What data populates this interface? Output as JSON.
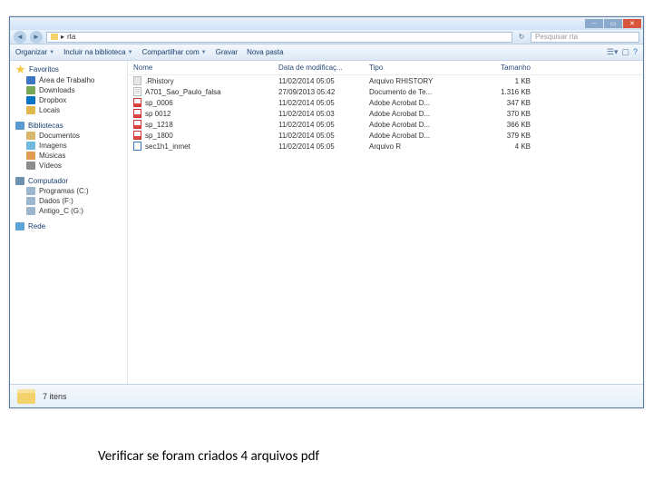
{
  "window": {
    "path_folder": "rta",
    "search_placeholder": "Pesquisar rta"
  },
  "toolbar": {
    "organize": "Organizar",
    "include": "Incluir na biblioteca",
    "share": "Compartilhar com",
    "burn": "Gravar",
    "newfolder": "Nova pasta"
  },
  "columns": {
    "name": "Nome",
    "date": "Data de modificaç...",
    "type": "Tipo",
    "size": "Tamanho"
  },
  "sidebar": {
    "favorites": "Favoritos",
    "desktop": "Área de Trabalho",
    "downloads": "Downloads",
    "dropbox": "Dropbox",
    "locals": "Locais",
    "libraries": "Bibliotecas",
    "documents": "Documentos",
    "images": "Imagens",
    "music": "Músicas",
    "videos": "Vídeos",
    "computer": "Computador",
    "drive_c": "Programas (C:)",
    "drive_f": "Dados (F:)",
    "drive_g": "Antigo_C (G:)",
    "network": "Rede"
  },
  "files": [
    {
      "name": ".Rhistory",
      "date": "11/02/2014 05:05",
      "type": "Arquivo RHISTORY",
      "size": "1 KB",
      "icon": "fi-hist"
    },
    {
      "name": "A701_Sao_Paulo_falsa",
      "date": "27/09/2013 05:42",
      "type": "Documento de Te...",
      "size": "1.316 KB",
      "icon": "fi-txt"
    },
    {
      "name": "sp_0006",
      "date": "11/02/2014 05:05",
      "type": "Adobe Acrobat D...",
      "size": "347 KB",
      "icon": "fi-pdf"
    },
    {
      "name": "sp 0012",
      "date": "11/02/2014 05:03",
      "type": "Adobe Acrobat D...",
      "size": "370 KB",
      "icon": "fi-pdf"
    },
    {
      "name": "sp_1218",
      "date": "11/02/2014 05:05",
      "type": "Adobe Acrobat D...",
      "size": "366 KB",
      "icon": "fi-pdf"
    },
    {
      "name": "sp_1800",
      "date": "11/02/2014 05:05",
      "type": "Adobe Acrobat D...",
      "size": "379 KB",
      "icon": "fi-pdf"
    },
    {
      "name": "sec1h1_inmet",
      "date": "11/02/2014 05:05",
      "type": "Arquivo R",
      "size": "4 KB",
      "icon": "fi-r"
    }
  ],
  "status": {
    "count": "7 itens"
  },
  "caption": "Verificar se foram criados 4 arquivos pdf"
}
